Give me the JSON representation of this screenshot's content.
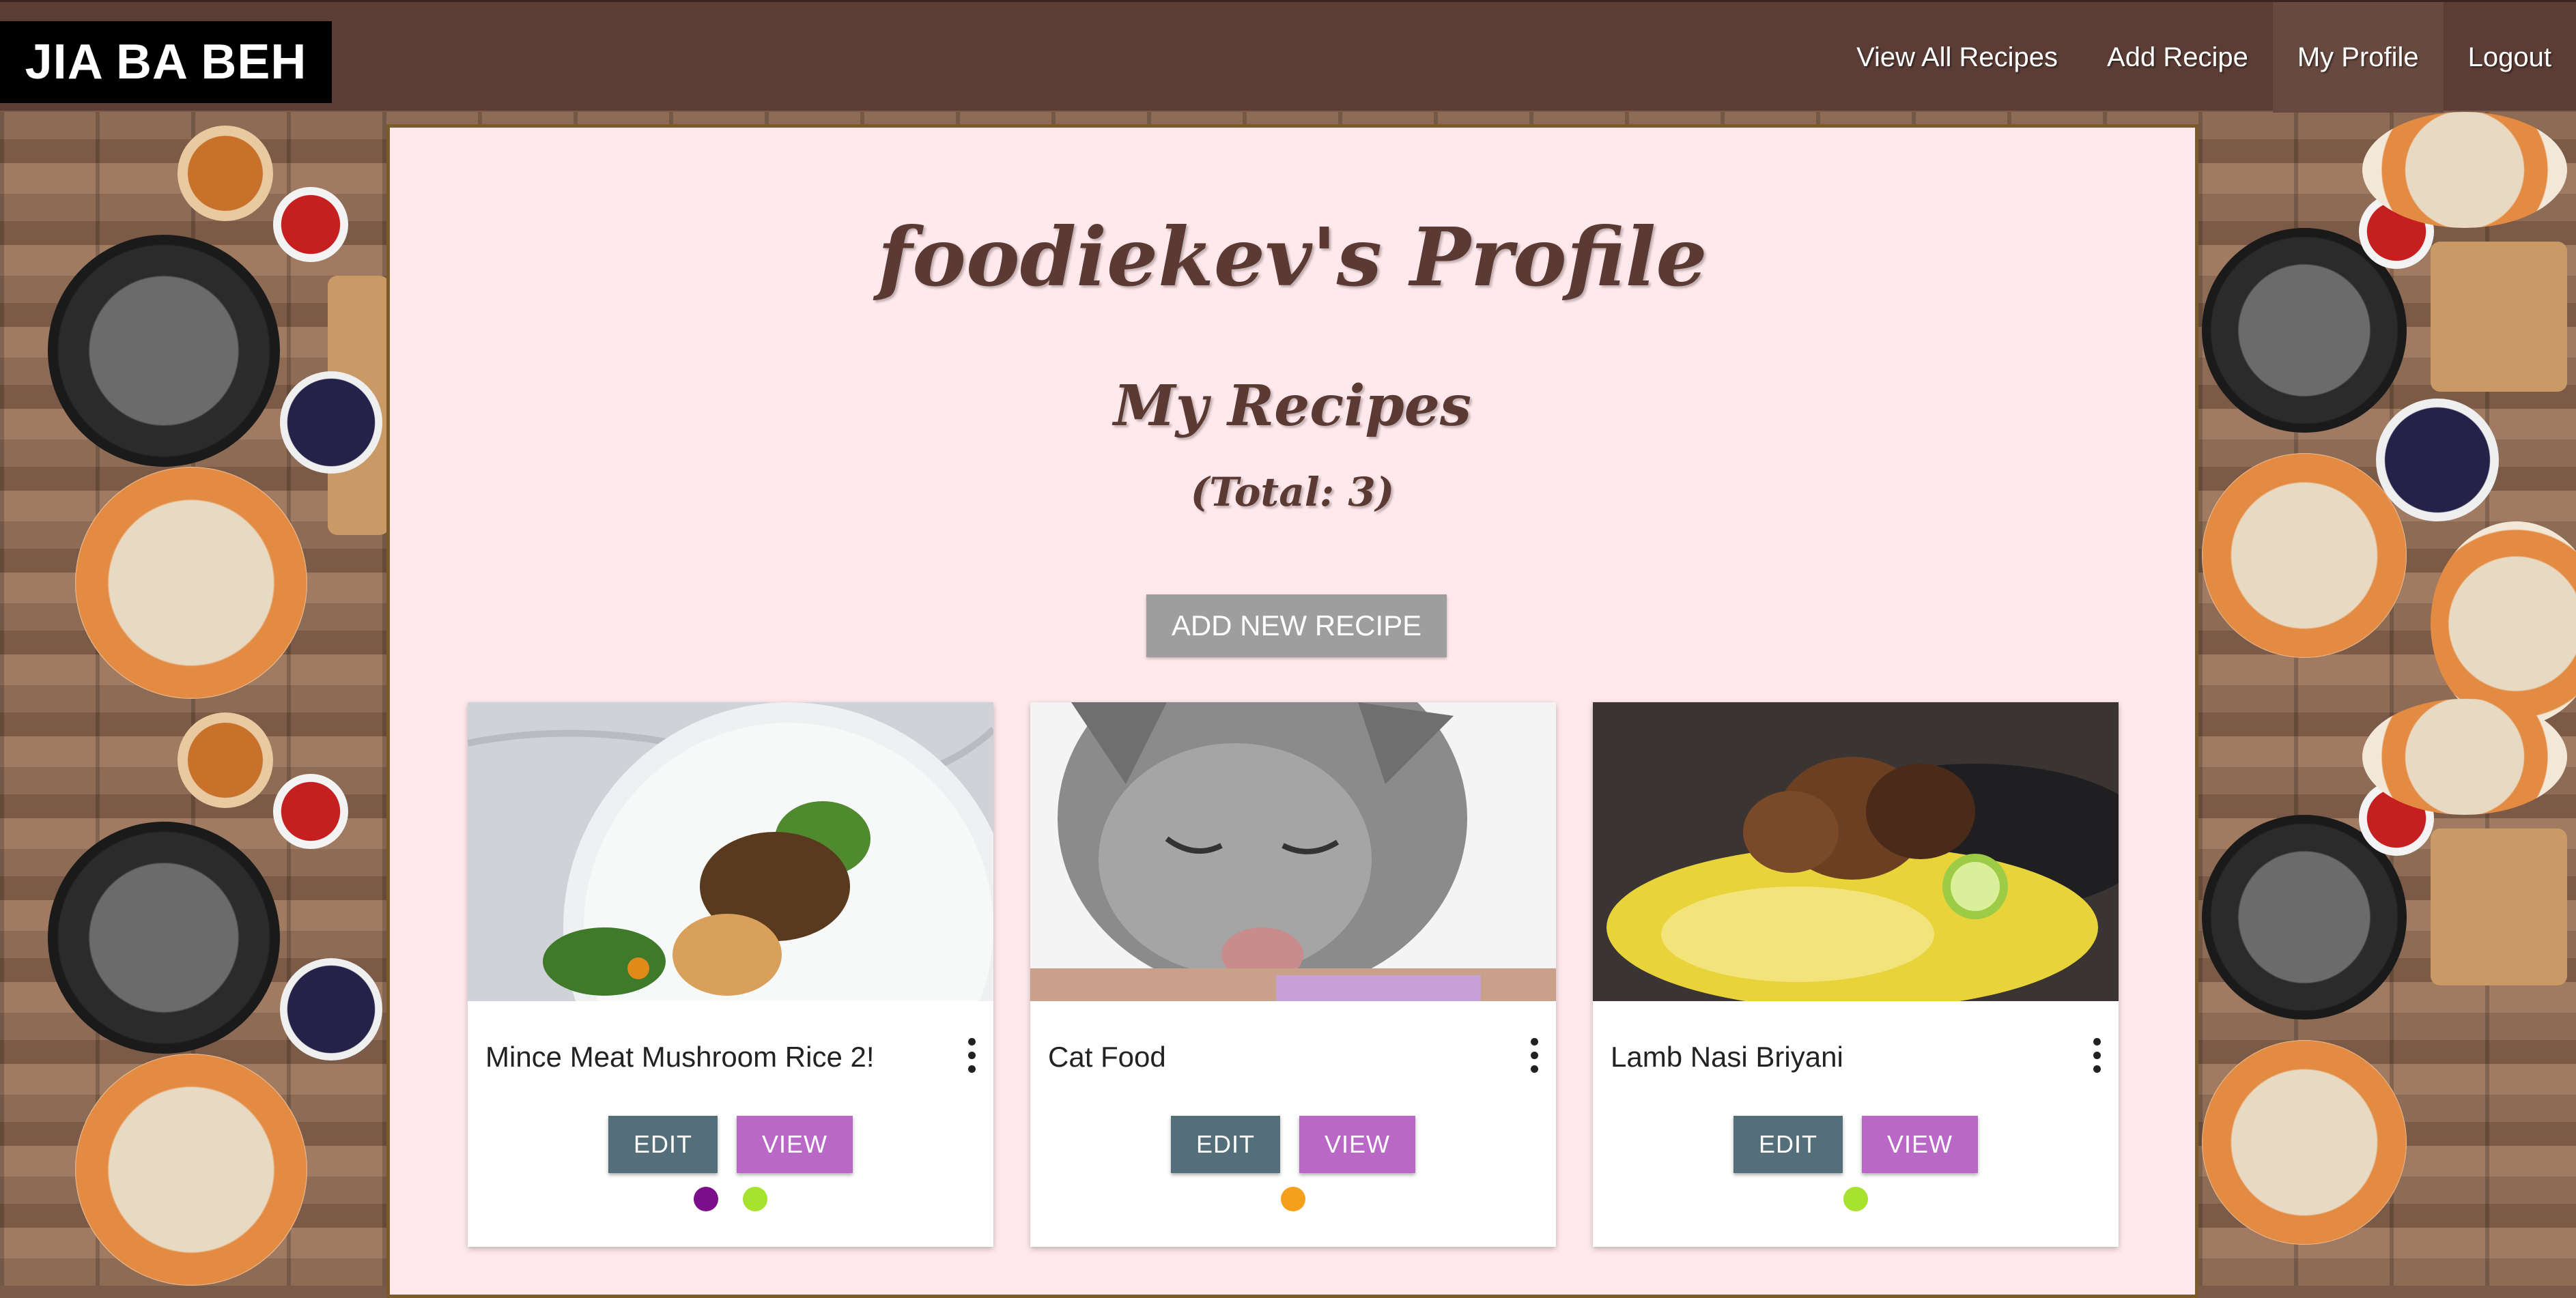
{
  "navbar": {
    "logo": "JIA BA BEH",
    "links": [
      {
        "label": "View All Recipes"
      },
      {
        "label": "Add Recipe"
      },
      {
        "label": "My Profile"
      },
      {
        "label": "Logout"
      }
    ]
  },
  "profile": {
    "title": "foodiekev's Profile",
    "section_title": "My Recipes",
    "total": "(Total: 3)",
    "add_button": "ADD NEW RECIPE"
  },
  "recipes": [
    {
      "title": "Mince Meat Mushroom Rice 2!",
      "edit": "EDIT",
      "view": "VIEW",
      "tags": [
        "#7b0f8a",
        "#a6e22e"
      ]
    },
    {
      "title": "Cat Food",
      "edit": "EDIT",
      "view": "VIEW",
      "tags": [
        "#f5a01a"
      ]
    },
    {
      "title": "Lamb Nasi Briyani",
      "edit": "EDIT",
      "view": "VIEW",
      "tags": [
        "#a6e22e"
      ]
    }
  ],
  "colors": {
    "navbar": "#5b3d36",
    "panel": "#ffe9ec",
    "edit_button": "#546e7a",
    "view_button": "#ba68c8",
    "add_button": "#9e9e9e"
  }
}
